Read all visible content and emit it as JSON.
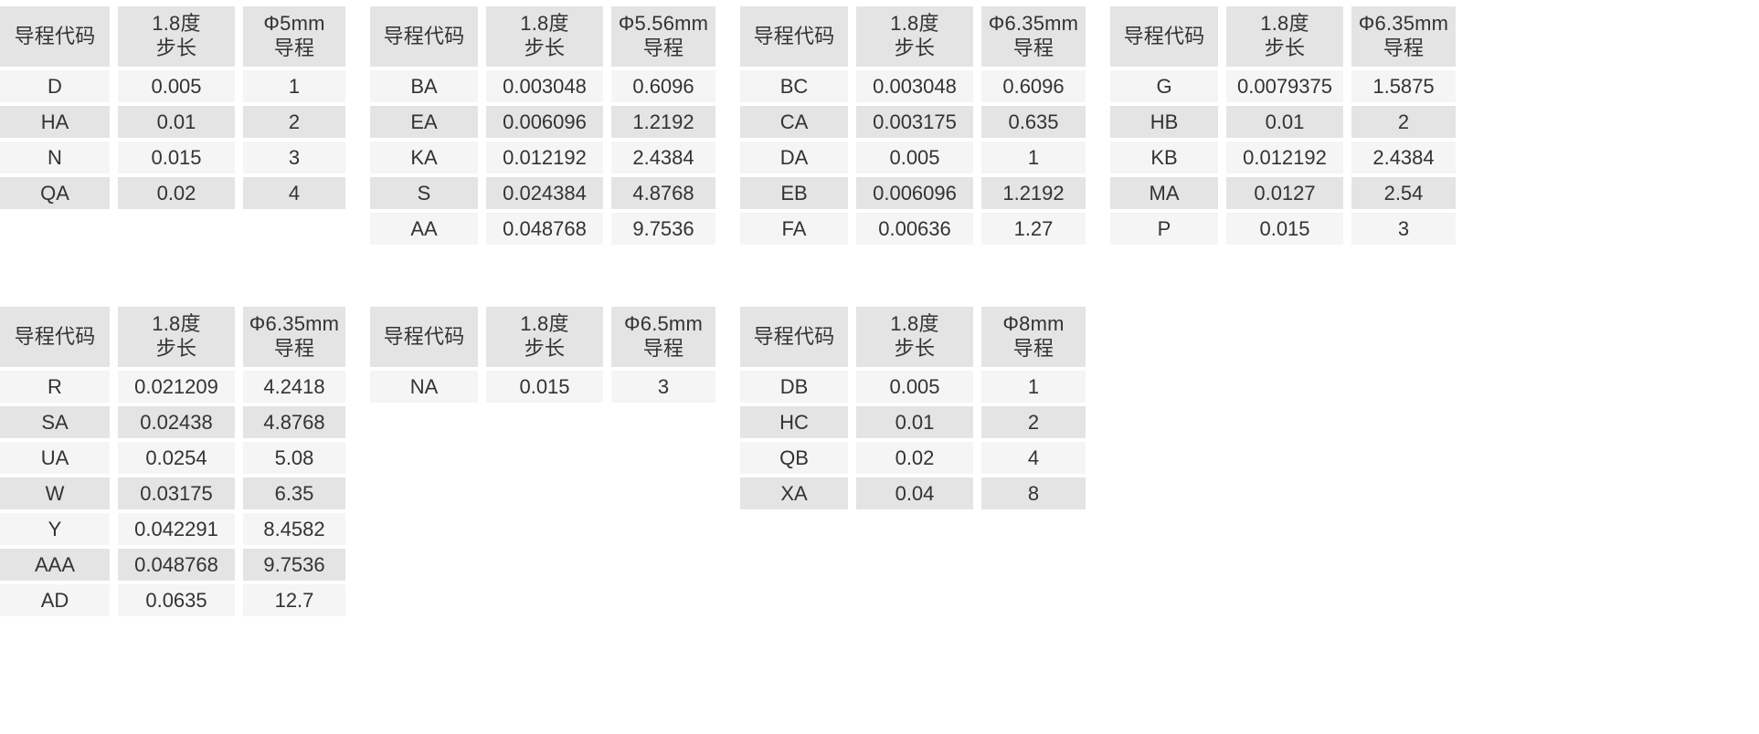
{
  "tables": [
    {
      "id": "table-lead-5mm",
      "headers": {
        "code": "导程代码",
        "step_line1": "1.8度",
        "step_line2": "步长",
        "lead_line1": "Φ5mm",
        "lead_line2": "导程"
      },
      "rows": [
        {
          "code": "D",
          "step": "0.005",
          "lead": "1"
        },
        {
          "code": "HA",
          "step": "0.01",
          "lead": "2"
        },
        {
          "code": "N",
          "step": "0.015",
          "lead": "3"
        },
        {
          "code": "QA",
          "step": "0.02",
          "lead": "4"
        }
      ]
    },
    {
      "id": "table-lead-5-56mm",
      "headers": {
        "code": "导程代码",
        "step_line1": "1.8度",
        "step_line2": "步长",
        "lead_line1": "Φ5.56mm",
        "lead_line2": "导程"
      },
      "rows": [
        {
          "code": "BA",
          "step": "0.003048",
          "lead": "0.6096"
        },
        {
          "code": "EA",
          "step": "0.006096",
          "lead": "1.2192"
        },
        {
          "code": "KA",
          "step": "0.012192",
          "lead": "2.4384"
        },
        {
          "code": "S",
          "step": "0.024384",
          "lead": "4.8768"
        },
        {
          "code": "AA",
          "step": "0.048768",
          "lead": "9.7536"
        }
      ]
    },
    {
      "id": "table-lead-6-35mm-a",
      "headers": {
        "code": "导程代码",
        "step_line1": "1.8度",
        "step_line2": "步长",
        "lead_line1": "Φ6.35mm",
        "lead_line2": "导程"
      },
      "rows": [
        {
          "code": "BC",
          "step": "0.003048",
          "lead": "0.6096"
        },
        {
          "code": "CA",
          "step": "0.003175",
          "lead": "0.635"
        },
        {
          "code": "DA",
          "step": "0.005",
          "lead": "1"
        },
        {
          "code": "EB",
          "step": "0.006096",
          "lead": "1.2192"
        },
        {
          "code": "FA",
          "step": "0.00636",
          "lead": "1.27"
        }
      ]
    },
    {
      "id": "table-lead-6-35mm-b",
      "headers": {
        "code": "导程代码",
        "step_line1": "1.8度",
        "step_line2": "步长",
        "lead_line1": "Φ6.35mm",
        "lead_line2": "导程"
      },
      "rows": [
        {
          "code": "G",
          "step": "0.0079375",
          "lead": "1.5875"
        },
        {
          "code": "HB",
          "step": "0.01",
          "lead": "2"
        },
        {
          "code": "KB",
          "step": "0.012192",
          "lead": "2.4384"
        },
        {
          "code": "MA",
          "step": "0.0127",
          "lead": "2.54"
        },
        {
          "code": "P",
          "step": "0.015",
          "lead": "3"
        }
      ]
    },
    {
      "id": "table-lead-6-35mm-c",
      "headers": {
        "code": "导程代码",
        "step_line1": "1.8度",
        "step_line2": "步长",
        "lead_line1": "Φ6.35mm",
        "lead_line2": "导程"
      },
      "rows": [
        {
          "code": "R",
          "step": "0.021209",
          "lead": "4.2418"
        },
        {
          "code": "SA",
          "step": "0.02438",
          "lead": "4.8768"
        },
        {
          "code": "UA",
          "step": "0.0254",
          "lead": "5.08"
        },
        {
          "code": "W",
          "step": "0.03175",
          "lead": "6.35"
        },
        {
          "code": "Y",
          "step": "0.042291",
          "lead": "8.4582"
        },
        {
          "code": "AAA",
          "step": "0.048768",
          "lead": "9.7536"
        },
        {
          "code": "AD",
          "step": "0.0635",
          "lead": "12.7"
        }
      ]
    },
    {
      "id": "table-lead-6-5mm",
      "headers": {
        "code": "导程代码",
        "step_line1": "1.8度",
        "step_line2": "步长",
        "lead_line1": "Φ6.5mm",
        "lead_line2": "导程"
      },
      "rows": [
        {
          "code": "NA",
          "step": "0.015",
          "lead": "3"
        }
      ]
    },
    {
      "id": "table-lead-8mm",
      "headers": {
        "code": "导程代码",
        "step_line1": "1.8度",
        "step_line2": "步长",
        "lead_line1": "Φ8mm",
        "lead_line2": "导程"
      },
      "rows": [
        {
          "code": "DB",
          "step": "0.005",
          "lead": "1"
        },
        {
          "code": "HC",
          "step": "0.01",
          "lead": "2"
        },
        {
          "code": "QB",
          "step": "0.02",
          "lead": "4"
        },
        {
          "code": "XA",
          "step": "0.04",
          "lead": "8"
        }
      ]
    }
  ],
  "colors": {
    "header_bg": "#e4e4e4",
    "row_bg_light": "#f5f5f5",
    "row_bg_alt": "#e4e4e4",
    "text": "#333333",
    "page_bg": "#ffffff"
  }
}
